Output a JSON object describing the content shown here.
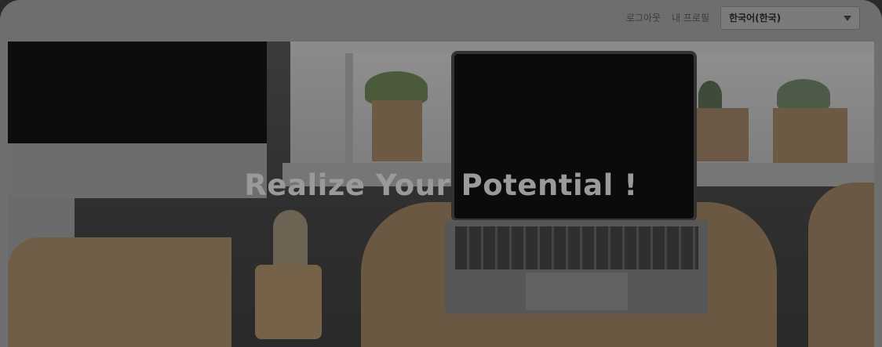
{
  "header": {
    "links": [
      "로그아웃",
      "내 프로필"
    ],
    "language_select": {
      "selected": "한국어(한국)"
    }
  },
  "hero": {
    "title": "Realize Your Potential !"
  },
  "icons": [
    "chevron-down-icon"
  ],
  "colors": {
    "overlay": "#6f6f6f",
    "title": "#9a9a9a"
  }
}
